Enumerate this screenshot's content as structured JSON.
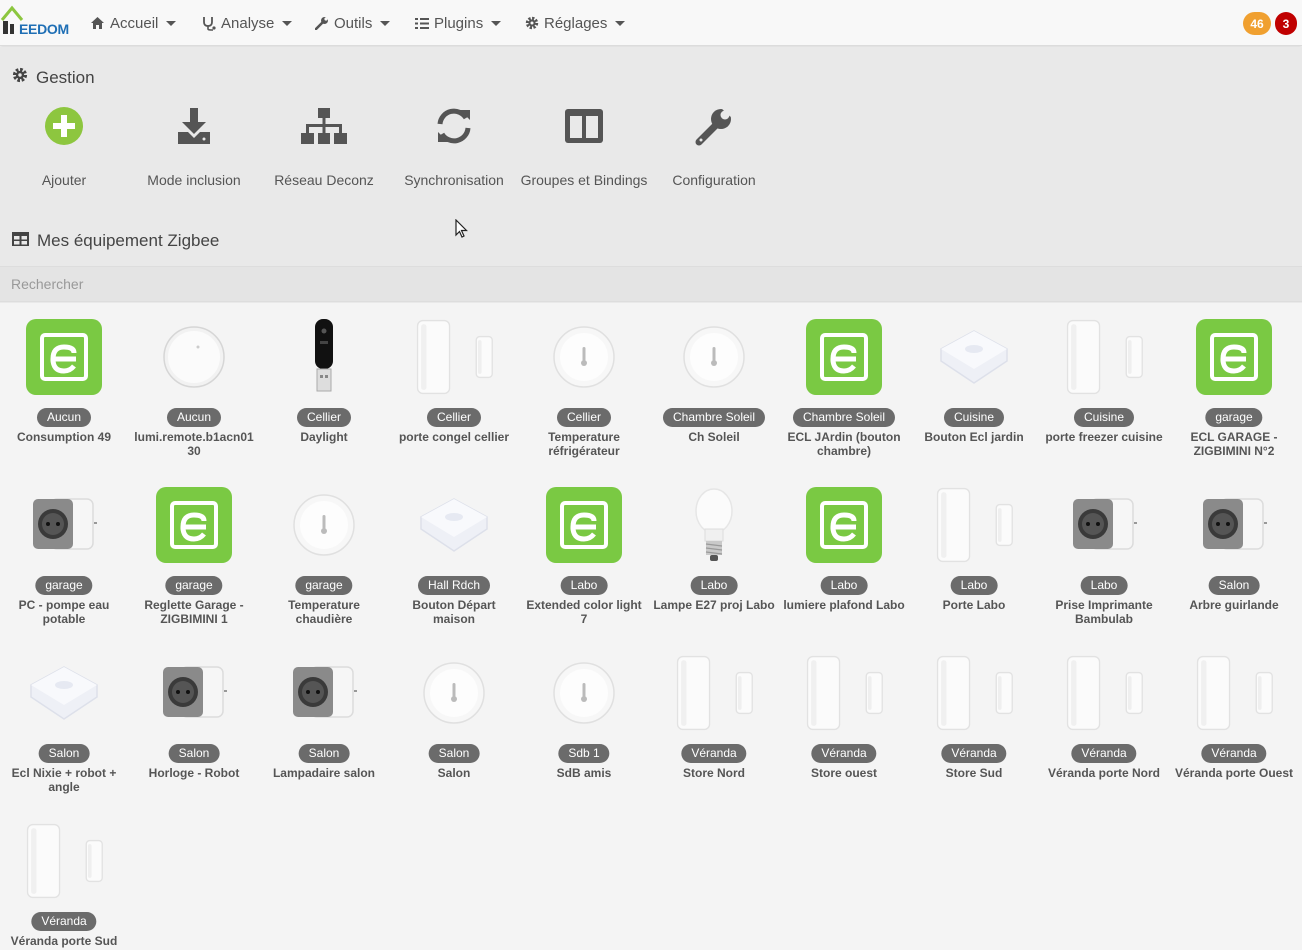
{
  "app": {
    "logo_text": "EEDOM",
    "colors": {
      "brand_blue": "#1f6fb5",
      "logo_green": "#8cc63f",
      "add_green": "#8dc63f",
      "enocean_green": "#7ac943",
      "badge_orange": "#f0a030",
      "badge_red": "#c00000",
      "room_tag": "#6b6b6b"
    }
  },
  "nav": {
    "items": [
      {
        "label": "Accueil",
        "icon": "home-icon"
      },
      {
        "label": "Analyse",
        "icon": "stethoscope-icon"
      },
      {
        "label": "Outils",
        "icon": "wrench-icon"
      },
      {
        "label": "Plugins",
        "icon": "tasks-icon"
      },
      {
        "label": "Réglages",
        "icon": "gear-icon"
      }
    ],
    "badges": [
      {
        "value": "46",
        "color": "#f0a030"
      },
      {
        "value": "3",
        "color": "#c00000"
      }
    ]
  },
  "gestion": {
    "title": "Gestion",
    "actions": [
      {
        "label": "Ajouter",
        "icon": "plus-circle-icon"
      },
      {
        "label": "Mode inclusion",
        "icon": "download-icon"
      },
      {
        "label": "Réseau Deconz",
        "icon": "sitemap-icon"
      },
      {
        "label": "Synchronisation",
        "icon": "sync-icon"
      },
      {
        "label": "Groupes et Bindings",
        "icon": "columns-icon"
      },
      {
        "label": "Configuration",
        "icon": "wrench-icon"
      }
    ]
  },
  "equipments": {
    "title": "Mes équipement Zigbee",
    "search_placeholder": "Rechercher",
    "items": [
      {
        "room": "Aucun",
        "name": "Consumption 49",
        "type": "enocean"
      },
      {
        "room": "Aucun",
        "name": "lumi.remote.b1acn01 30",
        "type": "round-button"
      },
      {
        "room": "Cellier",
        "name": "Daylight",
        "type": "usb-key"
      },
      {
        "room": "Cellier",
        "name": "porte congel cellier",
        "type": "door-sensor"
      },
      {
        "room": "Cellier",
        "name": "Temperature réfrigérateur",
        "type": "temp-sensor"
      },
      {
        "room": "Chambre Soleil",
        "name": "Ch Soleil",
        "type": "temp-sensor"
      },
      {
        "room": "Chambre Soleil",
        "name": "ECL JArdin (bouton chambre)",
        "type": "enocean"
      },
      {
        "room": "Cuisine",
        "name": "Bouton Ecl jardin",
        "type": "square-button"
      },
      {
        "room": "Cuisine",
        "name": "porte freezer cuisine",
        "type": "door-sensor"
      },
      {
        "room": "garage",
        "name": "ECL GARAGE - ZIGBIMINI N°2",
        "type": "enocean"
      },
      {
        "room": "garage",
        "name": "PC - pompe eau potable",
        "type": "smart-plug"
      },
      {
        "room": "garage",
        "name": "Reglette Garage - ZIGBIMINI 1",
        "type": "enocean"
      },
      {
        "room": "garage",
        "name": "Temperature chaudière",
        "type": "temp-sensor"
      },
      {
        "room": "Hall Rdch",
        "name": "Bouton Départ maison",
        "type": "square-button"
      },
      {
        "room": "Labo",
        "name": "Extended color light 7",
        "type": "enocean"
      },
      {
        "room": "Labo",
        "name": "Lampe E27 proj Labo",
        "type": "bulb"
      },
      {
        "room": "Labo",
        "name": "lumiere plafond Labo",
        "type": "enocean"
      },
      {
        "room": "Labo",
        "name": "Porte Labo",
        "type": "door-sensor"
      },
      {
        "room": "Labo",
        "name": "Prise Imprimante Bambulab",
        "type": "smart-plug"
      },
      {
        "room": "Salon",
        "name": "Arbre guirlande",
        "type": "smart-plug"
      },
      {
        "room": "Salon",
        "name": "Ecl Nixie + robot + angle",
        "type": "square-button"
      },
      {
        "room": "Salon",
        "name": "Horloge - Robot",
        "type": "smart-plug"
      },
      {
        "room": "Salon",
        "name": "Lampadaire salon",
        "type": "smart-plug"
      },
      {
        "room": "Salon",
        "name": "Salon",
        "type": "temp-sensor"
      },
      {
        "room": "Sdb 1",
        "name": "SdB amis",
        "type": "temp-sensor"
      },
      {
        "room": "Véranda",
        "name": "Store Nord",
        "type": "door-sensor"
      },
      {
        "room": "Véranda",
        "name": "Store ouest",
        "type": "door-sensor"
      },
      {
        "room": "Véranda",
        "name": "Store Sud",
        "type": "door-sensor"
      },
      {
        "room": "Véranda",
        "name": "Véranda porte Nord",
        "type": "door-sensor"
      },
      {
        "room": "Véranda",
        "name": "Véranda porte Ouest",
        "type": "door-sensor"
      },
      {
        "room": "Véranda",
        "name": "Véranda porte Sud",
        "type": "door-sensor"
      }
    ]
  }
}
